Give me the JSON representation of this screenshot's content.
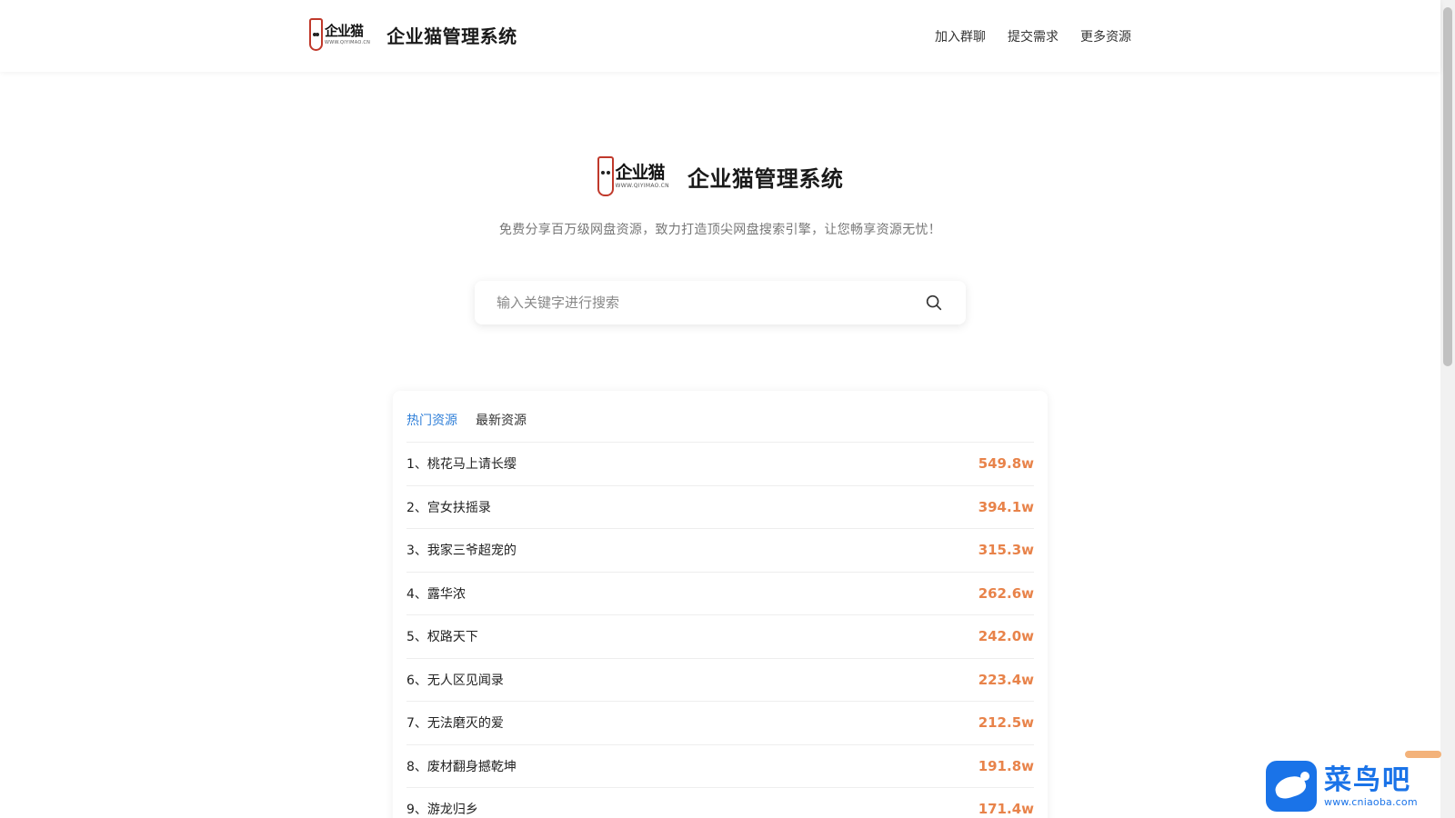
{
  "header": {
    "brand_title": "企业猫管理系统",
    "logo_text": "企业猫",
    "logo_sub": "WWW.QIYIMAO.CN",
    "nav": [
      {
        "label": "加入群聊"
      },
      {
        "label": "提交需求"
      },
      {
        "label": "更多资源"
      }
    ]
  },
  "hero": {
    "title": "企业猫管理系统",
    "logo_text": "企业猫",
    "logo_sub": "WWW.QIYIMAO.CN",
    "tagline": "免费分享百万级网盘资源，致力打造顶尖网盘搜索引擎，让您畅享资源无忧！"
  },
  "search": {
    "placeholder": "输入关键字进行搜索",
    "value": "",
    "icon": "search-icon"
  },
  "resources": {
    "tabs": [
      {
        "label": "热门资源",
        "active": true
      },
      {
        "label": "最新资源",
        "active": false
      }
    ],
    "items": [
      {
        "name": "1、桃花马上请长缨",
        "count": "549.8w"
      },
      {
        "name": "2、宫女扶摇录",
        "count": "394.1w"
      },
      {
        "name": "3、我家三爷超宠的",
        "count": "315.3w"
      },
      {
        "name": "4、露华浓",
        "count": "262.6w"
      },
      {
        "name": "5、权路天下",
        "count": "242.0w"
      },
      {
        "name": "6、无人区见闻录",
        "count": "223.4w"
      },
      {
        "name": "7、无法磨灭的爱",
        "count": "212.5w"
      },
      {
        "name": "8、废材翻身撼乾坤",
        "count": "191.8w"
      },
      {
        "name": "9、游龙归乡",
        "count": "171.4w"
      }
    ]
  },
  "watermark": {
    "title": "菜鸟吧",
    "url": "www.cniaoba.com"
  },
  "colors": {
    "accent_blue": "#2f7fd8",
    "count_orange": "#e8834a",
    "logo_red": "#c0392b",
    "watermark_blue": "#1a73e8"
  }
}
